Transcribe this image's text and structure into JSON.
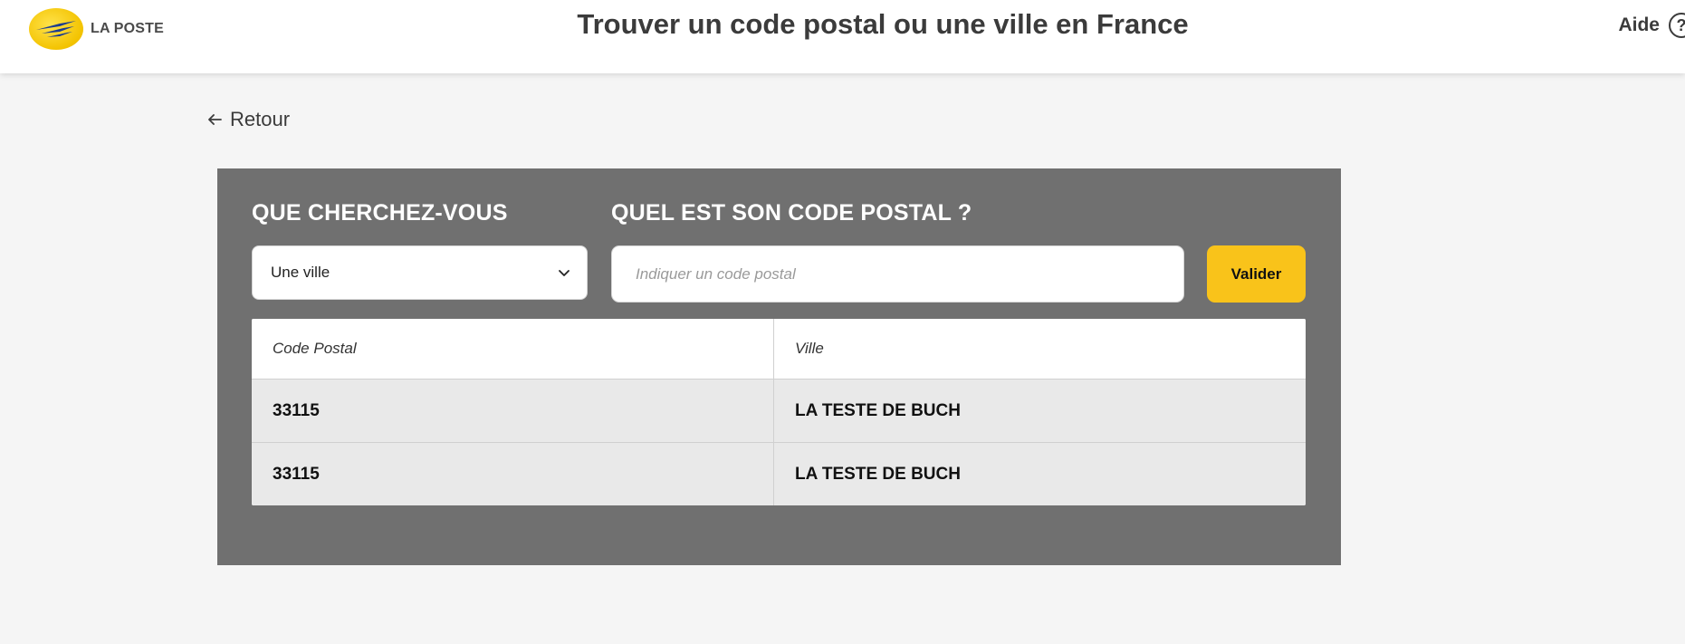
{
  "header": {
    "brand": "LA POSTE",
    "title": "Trouver un code postal ou une ville en France",
    "help_label": "Aide",
    "help_icon_glyph": "?"
  },
  "nav": {
    "back_label": "Retour"
  },
  "search": {
    "what_label": "QUE CHERCHEZ-VOUS",
    "what_value": "Une ville",
    "cp_label": "QUEL EST SON CODE POSTAL ?",
    "cp_placeholder": "Indiquer un code postal",
    "cp_value": "",
    "submit_label": "Valider"
  },
  "results": {
    "columns": [
      "Code Postal",
      "Ville"
    ],
    "rows": [
      [
        "33115",
        "LA TESTE DE BUCH"
      ],
      [
        "33115",
        "LA TESTE DE BUCH"
      ]
    ]
  },
  "colors": {
    "accent": "#f9c31a",
    "panel": "#707070",
    "logo_blue": "#1d3c8f"
  },
  "icons": {
    "logo": "la-poste-logo-icon",
    "help": "help-circle-icon",
    "back": "arrow-left-icon",
    "select": "chevron-down-icon"
  }
}
